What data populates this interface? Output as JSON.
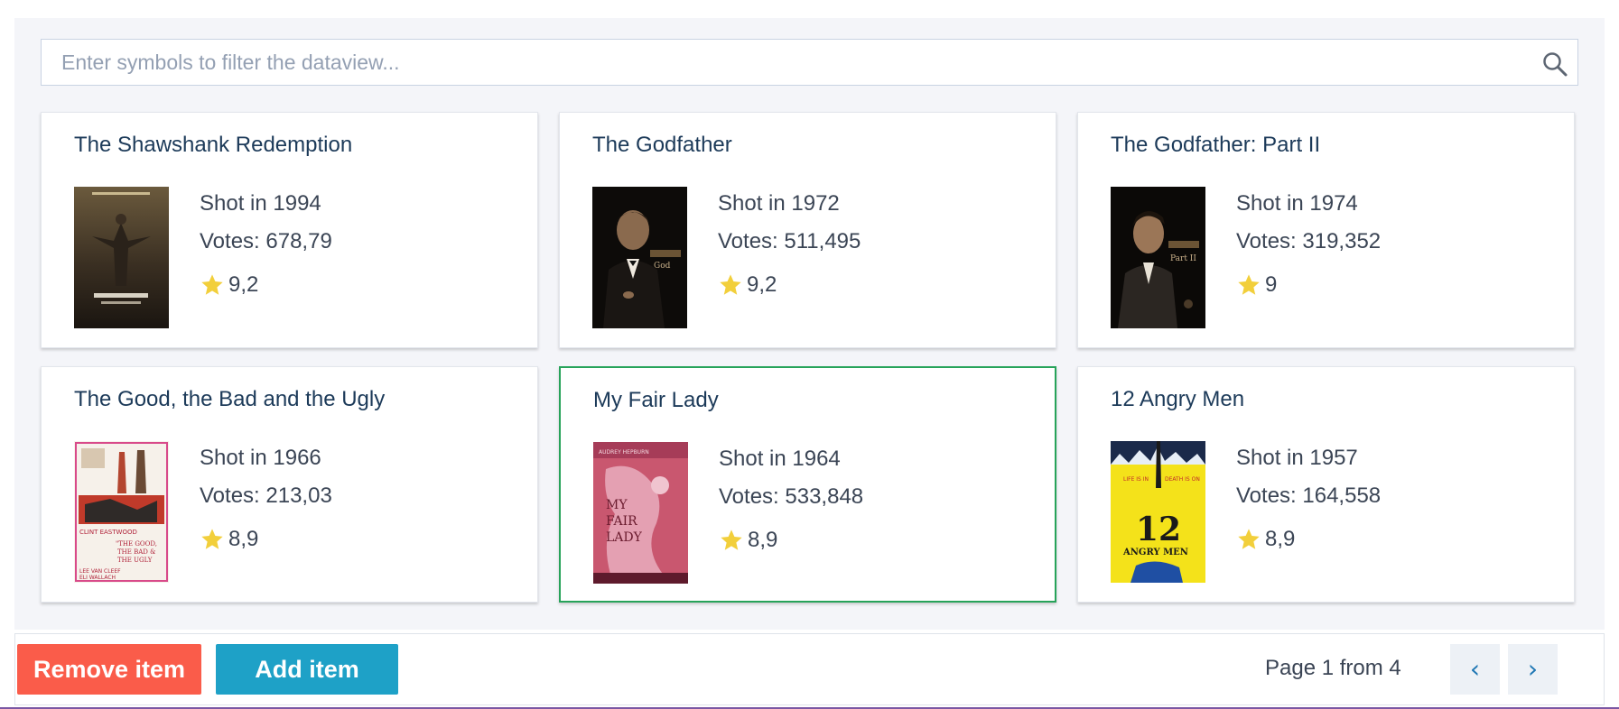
{
  "search": {
    "placeholder": "Enter symbols to filter the dataview...",
    "value": ""
  },
  "movies": [
    {
      "title": "The Shawshank Redemption",
      "shot": "Shot in 1994",
      "votes": "Votes: 678,79",
      "rating": "9,2"
    },
    {
      "title": "The Godfather",
      "shot": "Shot in 1972",
      "votes": "Votes: 511,495",
      "rating": "9,2"
    },
    {
      "title": "The Godfather: Part II",
      "shot": "Shot in 1974",
      "votes": "Votes: 319,352",
      "rating": "9"
    },
    {
      "title": "The Good, the Bad and the Ugly",
      "shot": "Shot in 1966",
      "votes": "Votes: 213,03",
      "rating": "8,9"
    },
    {
      "title": "My Fair Lady",
      "shot": "Shot in 1964",
      "votes": "Votes: 533,848",
      "rating": "8,9"
    },
    {
      "title": "12 Angry Men",
      "shot": "Shot in 1957",
      "votes": "Votes: 164,558",
      "rating": "8,9"
    }
  ],
  "selected_index": 4,
  "footer": {
    "remove_label": "Remove item",
    "add_label": "Add item",
    "page_info": "Page 1 from 4",
    "prev_label": "‹",
    "next_label": "›"
  },
  "icons": {
    "search": "search-icon",
    "star": "star-icon",
    "prev": "chevron-left-icon",
    "next": "chevron-right-icon"
  },
  "colors": {
    "remove_button": "#fa5c4a",
    "add_button": "#1ea1c7",
    "selected_border": "#27a35a",
    "star": "#f2cf3b",
    "title": "#1c3a59"
  }
}
